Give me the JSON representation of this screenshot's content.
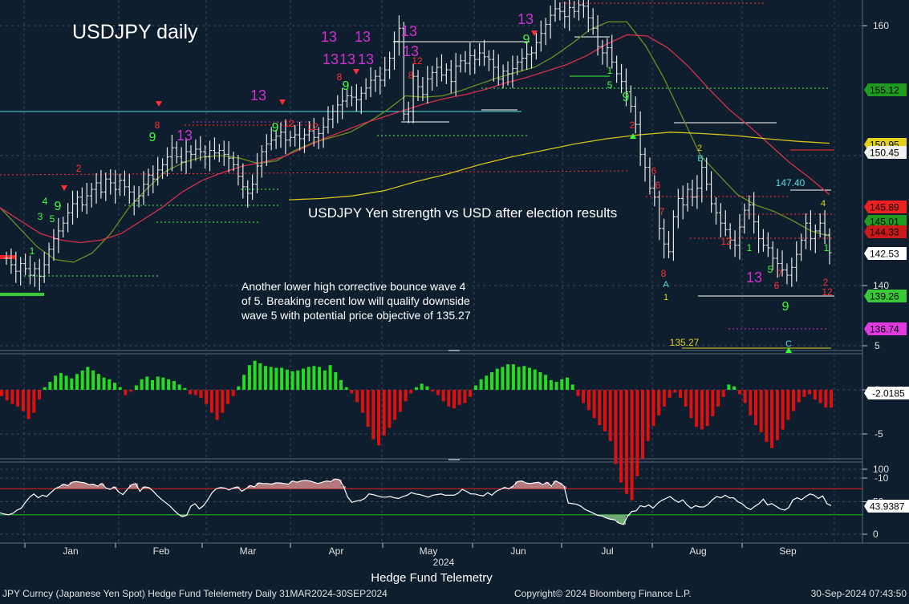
{
  "header": {
    "title": "USDJPY daily",
    "headline": "USDJPY Yen strength vs USD after election results",
    "note": [
      "Another lower high corrective bounce wave 4",
      "of 5.  Breaking recent low will qualify downside",
      "wave 5 with potential price objective of 135.27"
    ]
  },
  "footer": {
    "brand": "Hedge Fund Telemetry",
    "year": "2024",
    "security": "JPY Curncy (Japanese Yen Spot) Hedge Fund Telelemetry  Daily 31MAR2024-30SEP2024",
    "copyright": "Copyright© 2024 Bloomberg Finance L.P.",
    "timestamp": "30-Sep-2024 07:43:50"
  },
  "colors": {
    "background": "#0f1e2e",
    "candles": "#e8e8e8",
    "ma_short": "#6b8e23",
    "ma_mid": "#d8304a",
    "ma_long": "#d4c21a",
    "positive": "#22dd22",
    "negative": "#dd1111",
    "seq_green": "#39ff39",
    "seq_red": "#ff3030",
    "seq_magenta": "#d030d0",
    "level_cyan": "#55dddd"
  },
  "chart_data": [
    {
      "type": "line",
      "title": "USDJPY daily",
      "panel": "price",
      "x_axis": {
        "months": [
          "Jan",
          "Feb",
          "Mar",
          "Apr",
          "May",
          "Jun",
          "Jul",
          "Aug",
          "Sep"
        ],
        "year": "2024"
      },
      "ylim": [
        132.5,
        162
      ],
      "y_ticks": [
        140,
        160
      ],
      "series": [
        {
          "kind": "close_approx",
          "values": [
            142.1,
            141.6,
            141.1,
            141.7,
            141.3,
            140.8,
            141.3,
            140.7,
            141.6,
            142.8,
            143.6,
            144.2,
            144.8,
            145.6,
            146.3,
            146.8,
            146.2,
            146.9,
            147.4,
            147.9,
            147.2,
            148.2,
            147.9,
            147.4,
            148.1,
            147.6,
            147.2,
            146.5,
            146.9,
            147.8,
            148.5,
            148.2,
            148.9,
            149.3,
            149.9,
            150.6,
            149.9,
            149.5,
            150.3,
            150.1,
            150.5,
            150.3,
            149.9,
            150.4,
            150.2,
            150.4,
            150.1,
            149.8,
            149.3,
            148.4,
            147.6,
            147.1,
            147.8,
            149.2,
            150.3,
            150.9,
            151.2,
            151.5,
            151.8,
            151.2,
            151.4,
            151.6,
            151.3,
            151.6,
            151.9,
            151.4,
            151.7,
            152.2,
            152.8,
            153.4,
            153.9,
            154.2,
            154.6,
            154.5,
            154.3,
            154.8,
            155.2,
            155.8,
            156.1,
            155.8,
            156.6,
            157.5,
            158.8,
            159.8,
            153.2,
            153.4,
            156.1,
            155.3,
            154.7,
            155.9,
            156.4,
            156.8,
            156.2,
            156.6,
            155.7,
            156.9,
            157.3,
            157.1,
            157.7,
            157.4,
            157.9,
            157.6,
            157.4,
            156.8,
            155.9,
            156.5,
            156.3,
            156.7,
            157.2,
            157.5,
            157.8,
            157.9,
            158.7,
            159.4,
            160.1,
            160.8,
            161.3,
            161.1,
            160.7,
            161.4,
            161.1,
            161.6,
            161.5,
            160.6,
            159.8,
            158.4,
            157.9,
            158.3,
            157.2,
            156.3,
            155.7,
            154.9,
            153.8,
            152.4,
            150.1,
            149.1,
            147.5,
            146.8,
            144.4,
            143.2,
            142.6,
            145.3,
            146.7,
            146.2,
            147.4,
            146.8,
            147.5,
            149.1,
            147.8,
            146.3,
            145.6,
            144.8,
            144.3,
            143.5,
            143.1,
            144.5,
            145.8,
            146.2,
            144.9,
            143.6,
            143.1,
            142.9,
            142.1,
            141.7,
            141.2,
            140.8,
            141.4,
            142.4,
            143.5,
            144.8,
            143.6,
            144.2,
            144.8,
            143.9,
            142.53
          ]
        },
        {
          "name": "short moving average",
          "values": [
            146,
            144.5,
            143,
            142,
            141.8,
            142.5,
            144,
            146,
            147.5,
            148.8,
            149.5,
            149.9,
            150,
            149.8,
            149.4,
            149.6,
            150.4,
            151,
            151.4,
            151.8,
            152.6,
            153.5,
            154.6,
            154.5,
            154.6,
            155,
            155.5,
            156,
            156.4,
            156.8,
            157.6,
            158.6,
            159.7,
            160.3,
            160.3,
            158.5,
            156,
            153,
            150,
            148.5,
            147,
            146.2,
            145.7,
            145,
            144.2,
            143.8
          ]
        },
        {
          "name": "mid moving average",
          "values": [
            146,
            145,
            144,
            143.5,
            143.3,
            143.5,
            144,
            145,
            146,
            147.2,
            148.1,
            148.7,
            149.2,
            149.5,
            149.9,
            150.6,
            151.3,
            151.9,
            152.5,
            153,
            153.5,
            154,
            154.4,
            154.7,
            155.1,
            155.6,
            156,
            156.5,
            157,
            157.7,
            158.6,
            159.3,
            159.2,
            158.3,
            156.9,
            155.2,
            153.6,
            152.3,
            150.9,
            149.5,
            148.3,
            147
          ]
        },
        {
          "name": "long moving average",
          "values": [
            146.6,
            146.7,
            146.9,
            147.3,
            148,
            148.6,
            149.3,
            149.9,
            150.4,
            150.9,
            151.3,
            151.6,
            151.8,
            151.7,
            151.55,
            151.3,
            151.1,
            150.95
          ]
        }
      ],
      "right_axis_labels": [
        {
          "text": "155.12",
          "bg": "#1f9b1f",
          "fg": "#000000"
        },
        {
          "text": "150.95",
          "bg": "#e2d21f",
          "fg": "#000000"
        },
        {
          "text": "150.45",
          "bg": "#f0f0f0",
          "fg": "#000000"
        },
        {
          "text": "145.89",
          "bg": "#ee2020",
          "fg": "#000000"
        },
        {
          "text": "145.01",
          "bg": "#1f9b1f",
          "fg": "#000000"
        },
        {
          "text": "144.33",
          "bg": "#cc1a1a",
          "fg": "#000000"
        },
        {
          "text": "142.53",
          "bg": "#ffffff",
          "fg": "#000000"
        },
        {
          "text": "139.26",
          "bg": "#39c939",
          "fg": "#000000"
        },
        {
          "text": "136.74",
          "bg": "#e23ae2",
          "fg": "#000000"
        }
      ],
      "annotations": [
        {
          "text": "147.40",
          "color": "#55dddd"
        },
        {
          "text": "135.27",
          "color": "#e2d21f"
        },
        {
          "text": "A",
          "color": "#55dddd"
        },
        {
          "text": "B",
          "color": "#55dddd"
        },
        {
          "text": "C",
          "color": "#55dddd"
        },
        {
          "text": "1",
          "color": "#e2d21f"
        },
        {
          "text": "2",
          "color": "#e2d21f"
        },
        {
          "text": "4",
          "color": "#e2d21f"
        }
      ]
    },
    {
      "type": "bar",
      "panel": "oscillator",
      "ylim": [
        -13,
        5
      ],
      "y_ticks": [
        5,
        0,
        -5,
        -10
      ],
      "current_value_label": "-2.0185",
      "values": [
        -0.7,
        -1.2,
        -1.6,
        -1.9,
        -2.4,
        -3.3,
        -2.6,
        -1.1,
        0.3,
        0.9,
        1.6,
        1.9,
        1.6,
        1.3,
        1.8,
        2.2,
        2.6,
        2.2,
        1.8,
        1.4,
        1.2,
        0.8,
        0.3,
        -0.6,
        -0.2,
        0.5,
        1.2,
        1.5,
        1.1,
        1.5,
        1.4,
        1.2,
        1.0,
        0.6,
        0.2,
        -0.5,
        -0.6,
        -0.9,
        -1.6,
        -2.6,
        -3.4,
        -2.6,
        -1.6,
        -0.7,
        0.4,
        1.7,
        2.8,
        3.3,
        3.0,
        2.7,
        2.6,
        2.5,
        2.5,
        2.3,
        2.1,
        2.2,
        2.4,
        2.6,
        2.7,
        2.6,
        2.2,
        2.8,
        2.0,
        1.1,
        0.3,
        -0.4,
        -1.4,
        -2.6,
        -4.2,
        -5.6,
        -6.3,
        -5.2,
        -4.3,
        -3.4,
        -2.5,
        -1.3,
        -0.4,
        0.3,
        0.7,
        0.4,
        -0.2,
        -0.6,
        -1.3,
        -1.9,
        -2.1,
        -1.7,
        -1.5,
        -0.8,
        0.5,
        1.2,
        1.6,
        2.0,
        2.4,
        2.6,
        2.9,
        2.9,
        2.6,
        2.7,
        2.5,
        2.3,
        2.0,
        1.7,
        1.1,
        0.9,
        1.2,
        1.4,
        0.6,
        -0.7,
        -1.5,
        -2.3,
        -3.2,
        -4.0,
        -4.7,
        -5.8,
        -8.4,
        -10.5,
        -11.8,
        -12.5,
        -9.8,
        -7.8,
        -5.8,
        -4.1,
        -2.9,
        -1.9,
        -0.9,
        -0.3,
        -0.9,
        -1.9,
        -3.2,
        -4.2,
        -4.5,
        -4.1,
        -3.0,
        -1.9,
        -0.8,
        0.6,
        0.4,
        -0.5,
        -1.5,
        -2.9,
        -4.0,
        -4.8,
        -5.9,
        -6.6,
        -5.7,
        -4.5,
        -3.4,
        -2.4,
        -1.4,
        -0.8,
        -0.5,
        -1.1,
        -1.5,
        -2.0,
        -2.0185
      ]
    },
    {
      "type": "line",
      "panel": "momentum",
      "ylim": [
        -5,
        105
      ],
      "y_ticks": [
        100,
        50,
        0
      ],
      "reference_lines": [
        70,
        30
      ],
      "current_value_label": "43.9387",
      "values": [
        33,
        31,
        30,
        32,
        37,
        40,
        49,
        57,
        62,
        56,
        60,
        58,
        64,
        70,
        73,
        77,
        75,
        80,
        81,
        80,
        79,
        76,
        77,
        74,
        78,
        71,
        69,
        73,
        65,
        61,
        69,
        76,
        78,
        66,
        73,
        72,
        67,
        60,
        54,
        49,
        44,
        37,
        31,
        27,
        29,
        43,
        47,
        39,
        44,
        53,
        64,
        70,
        72,
        71,
        68,
        71,
        73,
        66,
        70,
        75,
        73,
        79,
        78,
        78,
        77,
        79,
        79,
        78,
        77,
        82,
        80,
        82,
        83,
        82,
        80,
        78,
        80,
        82,
        81,
        85,
        84,
        74,
        57,
        49,
        51,
        52,
        55,
        62,
        61,
        59,
        57,
        57,
        58,
        56,
        55,
        58,
        60,
        64,
        62,
        61,
        59,
        57,
        60,
        61,
        62,
        60,
        60,
        60,
        63,
        69,
        66,
        62,
        62,
        60,
        59,
        64,
        60,
        66,
        69,
        72,
        70,
        74,
        81,
        82,
        79,
        78,
        79,
        80,
        76,
        80,
        74,
        82,
        79,
        74,
        48,
        47,
        46,
        43,
        38,
        35,
        32,
        29,
        28,
        25,
        23,
        22,
        17,
        15,
        28,
        35,
        36,
        44,
        42,
        45,
        40,
        47,
        52,
        55,
        58,
        53,
        49,
        53,
        45,
        40,
        44,
        42,
        42,
        46,
        53,
        58,
        56,
        60,
        56,
        56,
        50,
        47,
        41,
        38,
        43,
        47,
        54,
        45,
        47,
        43,
        39,
        37,
        41,
        53,
        56,
        53,
        58,
        62,
        60,
        55,
        59,
        47,
        43.94
      ]
    }
  ],
  "signals": [
    {
      "text": "13",
      "color": "#d030d0"
    },
    {
      "text": "9",
      "color": "#39ff39"
    },
    {
      "text": "8",
      "color": "#ff3030"
    },
    {
      "text": "1",
      "color": "#39ff39"
    },
    {
      "text": "2",
      "color": "#ff3030"
    },
    {
      "text": "3",
      "color": "#39ff39"
    },
    {
      "text": "4",
      "color": "#39ff39"
    },
    {
      "text": "5",
      "color": "#39ff39"
    },
    {
      "text": "6",
      "color": "#ff3030"
    },
    {
      "text": "7",
      "color": "#ff3030"
    },
    {
      "text": "12",
      "color": "#ff3030"
    }
  ]
}
